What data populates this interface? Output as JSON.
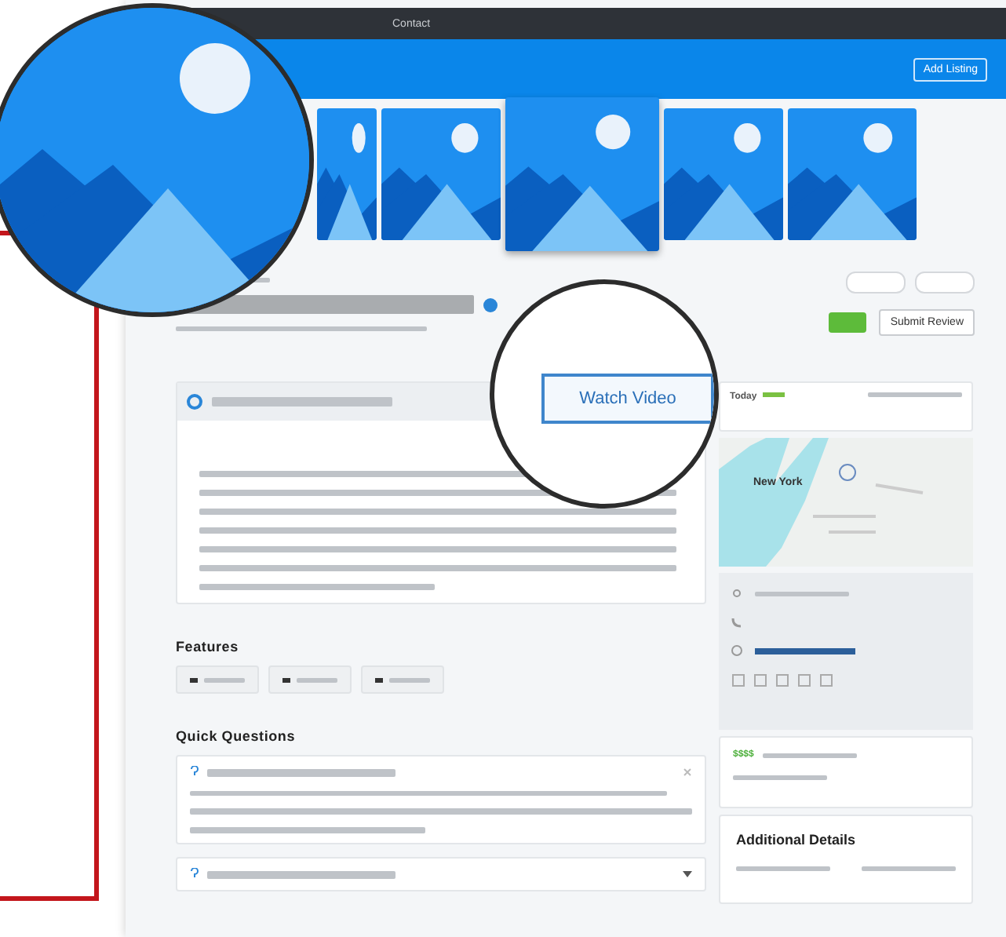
{
  "breadcrumb": "Contact",
  "header_button": "Add Listing",
  "listing": {
    "submit_button": "Submit Review"
  },
  "video_button": "Watch Video",
  "features": {
    "title": "Features",
    "chips": [
      {
        "kind": "tag"
      },
      {
        "kind": "tag"
      },
      {
        "kind": "tag"
      }
    ]
  },
  "quick_questions": {
    "title": "Quick Questions",
    "items": [
      {
        "expanded": true
      },
      {
        "expanded": false
      }
    ]
  },
  "hours": {
    "day": "Today"
  },
  "map": {
    "label": "New York"
  },
  "price": {
    "symbol": "$$$$"
  },
  "additional_details": {
    "title": "Additional Details"
  }
}
